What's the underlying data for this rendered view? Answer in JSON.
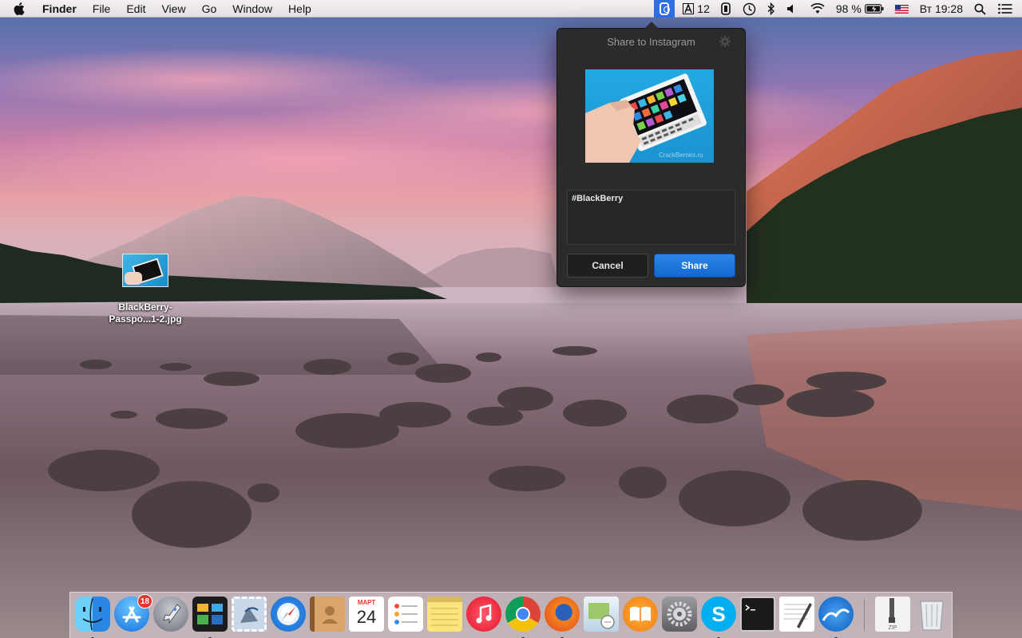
{
  "menubar": {
    "app_name": "Finder",
    "items": [
      "File",
      "Edit",
      "View",
      "Go",
      "Window",
      "Help"
    ],
    "status": {
      "input_source_count": "12",
      "battery": "98 %",
      "clock": "Вт 19:28"
    }
  },
  "desktop": {
    "file": {
      "name_line1": "BlackBerry-",
      "name_line2": "Passpo...1-2.jpg"
    }
  },
  "share_popover": {
    "title": "Share to Instagram",
    "caption": "#BlackBerry",
    "cancel_label": "Cancel",
    "share_label": "Share",
    "watermark": "CrackBerries.ru"
  },
  "dock": {
    "app_store_badge": "18",
    "calendar_month": "МАРТ",
    "calendar_day": "24",
    "items": [
      "finder-icon",
      "app-store-icon",
      "launchpad-icon",
      "mission-control-icon",
      "mail-icon",
      "safari-icon",
      "contacts-icon",
      "calendar-icon",
      "reminders-icon",
      "notes-icon",
      "itunes-icon",
      "chrome-icon",
      "firefox-icon",
      "preview-icon",
      "ibooks-icon",
      "system-preferences-icon",
      "skype-icon",
      "terminal-icon",
      "textedit-icon",
      "openoffice-icon",
      "archive-icon",
      "trash-icon"
    ]
  },
  "colors": {
    "menu_highlight": "#2f6ee5",
    "share_button": "#1a76dc",
    "popover_bg": "#2b2b2b",
    "badge_red": "#e6352e"
  }
}
